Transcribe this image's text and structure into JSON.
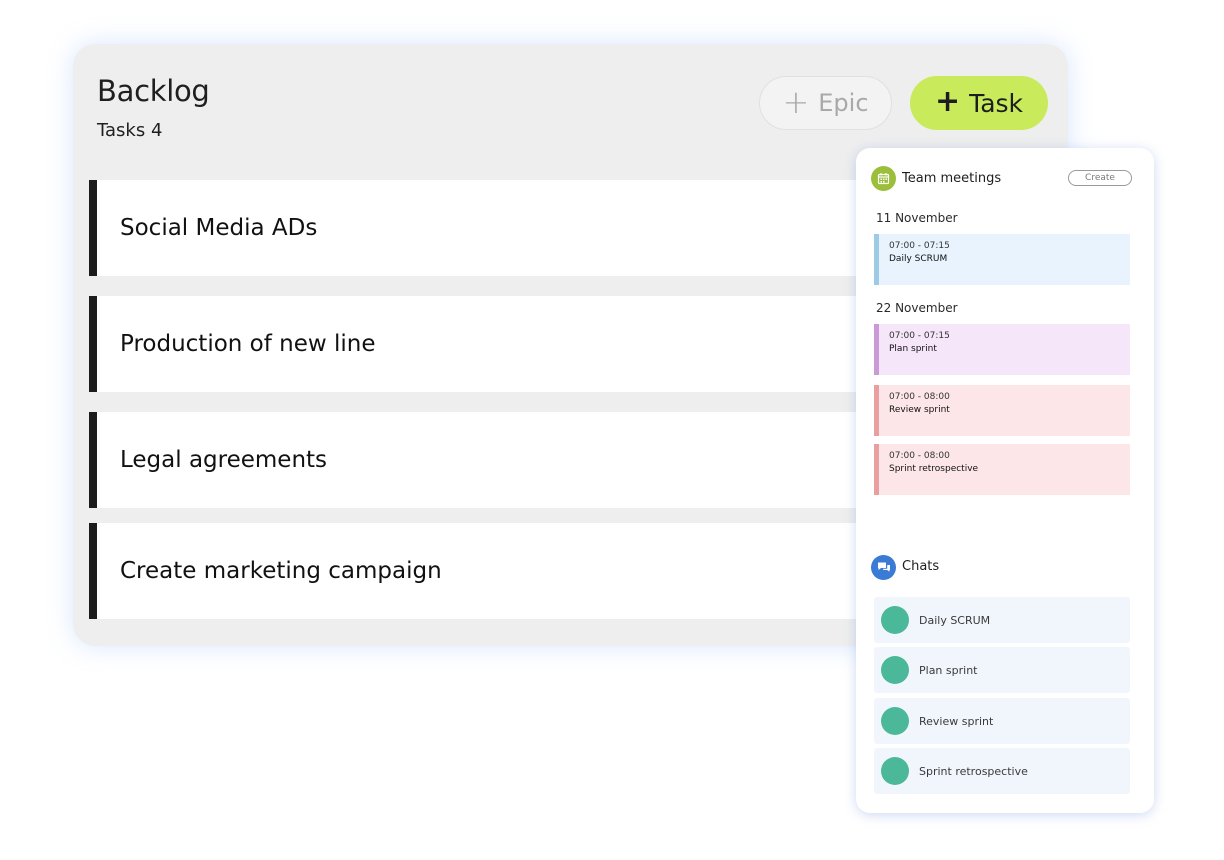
{
  "backlog": {
    "title": "Backlog",
    "count_label": "Tasks 4",
    "epic_button": {
      "icon": "plus-icon",
      "label": "Epic"
    },
    "task_button": {
      "icon": "plus-icon",
      "label": "Task",
      "color": "#c8ea5b"
    },
    "tasks": [
      {
        "label": "Social Media ADs"
      },
      {
        "label": "Production of new line"
      },
      {
        "label": "Legal agreements"
      },
      {
        "label": "Create marketing campaign"
      }
    ]
  },
  "meetings": {
    "icon": "calendar-icon",
    "title": "Team meetings",
    "create_label": "Create",
    "groups": [
      {
        "date": "11 November",
        "events": [
          {
            "time": "07:00 - 07:15",
            "name": "Daily SCRUM",
            "bg": "#e8f3fd",
            "bar": "#9dcbe5"
          }
        ]
      },
      {
        "date": "22 November",
        "events": [
          {
            "time": "07:00 - 07:15",
            "name": "Plan sprint",
            "bg": "#f5e6f9",
            "bar": "#c99ad6"
          },
          {
            "time": "07:00 - 08:00",
            "name": "Review sprint",
            "bg": "#fce6e8",
            "bar": "#e89f9f"
          },
          {
            "time": "07:00 - 08:00",
            "name": "Sprint retrospective",
            "bg": "#fce6e8",
            "bar": "#e89f9f"
          }
        ]
      }
    ]
  },
  "chats": {
    "icon": "chat-bubbles-icon",
    "title": "Chats",
    "items": [
      {
        "name": "Daily SCRUM"
      },
      {
        "name": "Plan sprint"
      },
      {
        "name": "Review sprint"
      },
      {
        "name": "Sprint retrospective"
      }
    ]
  }
}
